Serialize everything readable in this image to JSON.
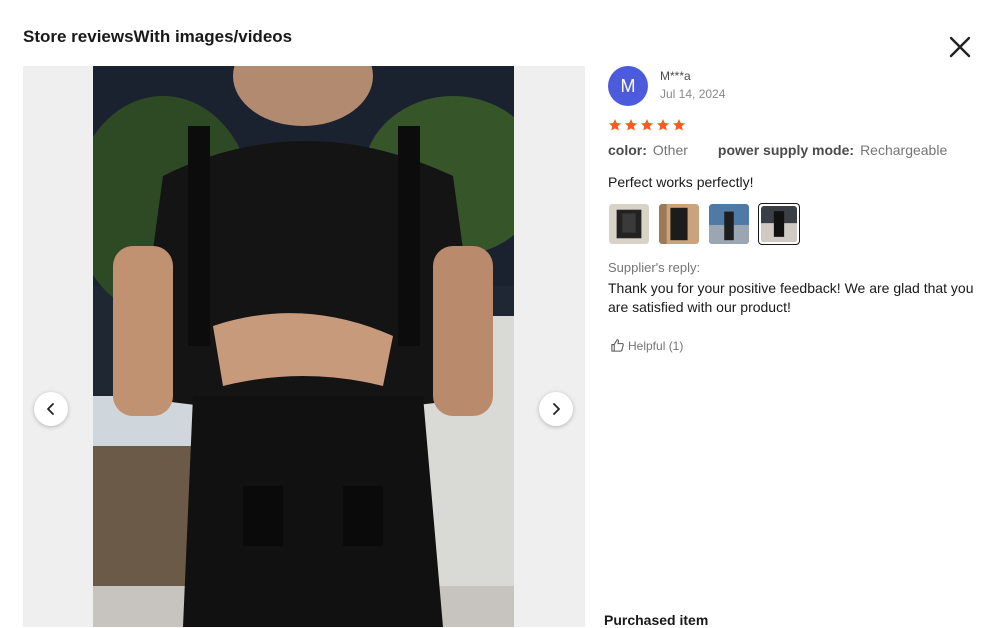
{
  "modal": {
    "title": "Store reviewsWith images/videos"
  },
  "review": {
    "avatar_letter": "M",
    "reviewer": "M***a",
    "date": "Jul 14, 2024",
    "rating": 5,
    "attributes": [
      {
        "key": "color",
        "value": "Other"
      },
      {
        "key": "power supply mode",
        "value": "Rechargeable"
      }
    ],
    "text": "Perfect works perfectly!",
    "thumbnails": 4,
    "selected_thumbnail": 4,
    "supplier_label": "Supplier's reply:",
    "supplier_reply": "Thank you for your positive feedback! We are glad that you are satisfied with our product!",
    "helpful_label": "Helpful (1)"
  },
  "purchased_item_label": "Purchased item",
  "colors": {
    "star": "#fd5b1d",
    "avatar": "#4b5bdb",
    "text": "#191919",
    "muted": "#757575"
  },
  "icons": {
    "close": "close-icon",
    "prev": "chevron-left-icon",
    "next": "chevron-right-icon",
    "star": "star-icon",
    "helpful": "thumbs-up-icon"
  }
}
